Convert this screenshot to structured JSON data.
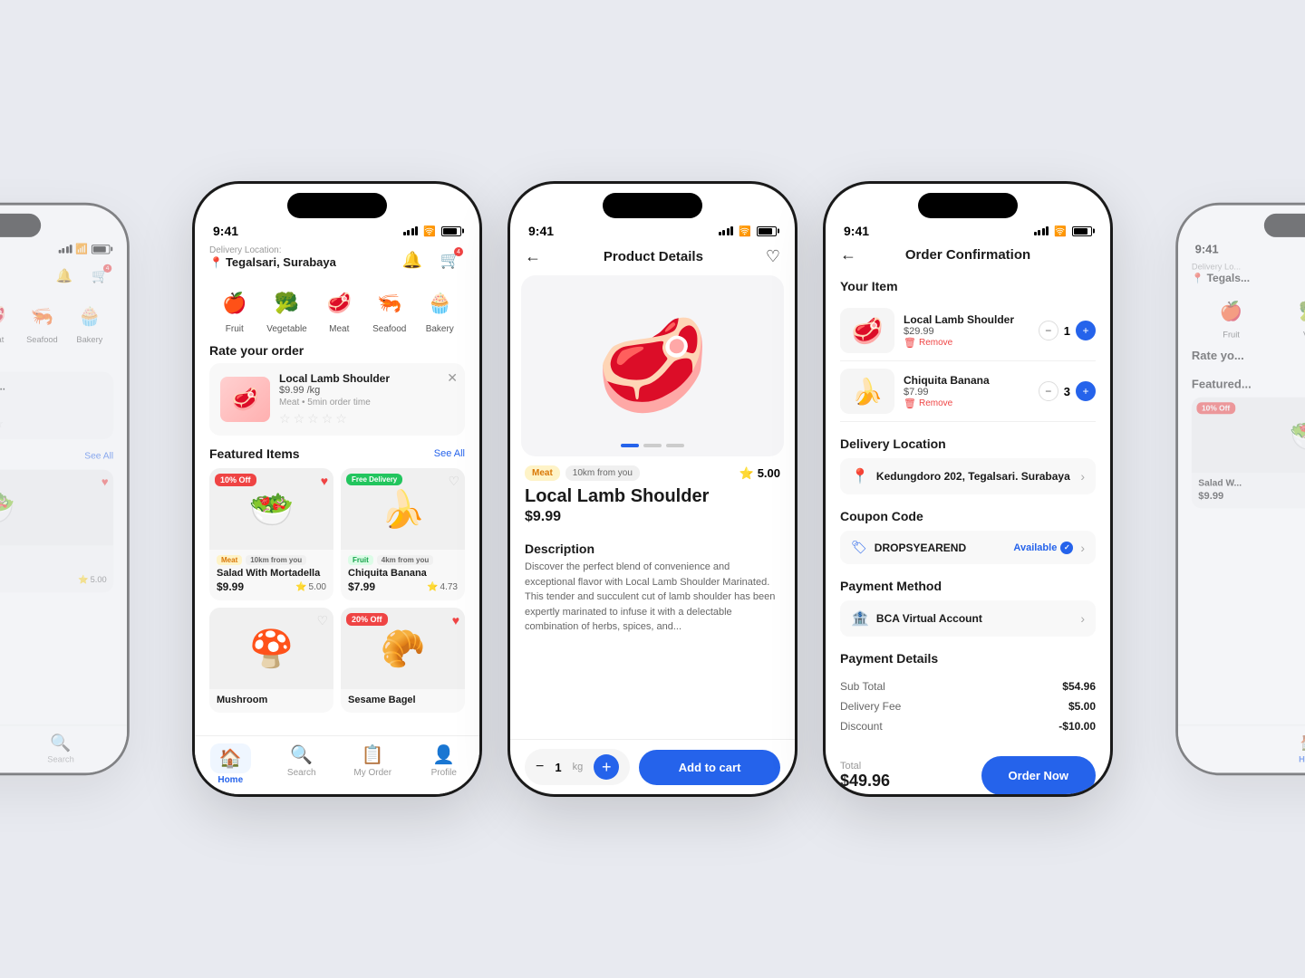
{
  "app": {
    "statusTime": "9:41",
    "theme": {
      "primary": "#2563eb",
      "danger": "#ef4444",
      "success": "#22c55e"
    }
  },
  "screen1": {
    "deliveryLabel": "Delivery Location:",
    "location": "Tegalsari, Surabaya",
    "categories": [
      {
        "icon": "🍎",
        "label": "Fruit"
      },
      {
        "icon": "🥦",
        "label": "Vegetable"
      },
      {
        "icon": "🥩",
        "label": "Meat"
      },
      {
        "icon": "🦐",
        "label": "Seafood"
      },
      {
        "icon": "🧁",
        "label": "Bakery"
      }
    ],
    "rateSection": {
      "title": "Rate your order",
      "product": {
        "name": "Local Lamb Shoulder",
        "price": "$9.99 /kg",
        "meta": "Meat • 5min order time"
      }
    },
    "featured": {
      "title": "Featured Items",
      "seeAll": "See All",
      "items": [
        {
          "badge": "10% Off",
          "badgeType": "discount",
          "name": "Salad With Mortadella",
          "price": "$9.99",
          "tags": [
            "Meat",
            "10km from you"
          ],
          "rating": "5.00",
          "heart": "filled"
        },
        {
          "badge": "Free Delivery",
          "badgeType": "free",
          "name": "Chiquita Banana",
          "price": "$7.99",
          "tags": [
            "Fruit",
            "4km from you"
          ],
          "rating": "4.73",
          "heart": "empty"
        }
      ]
    },
    "nav": [
      {
        "icon": "🏠",
        "label": "Home",
        "active": true
      },
      {
        "icon": "🔍",
        "label": "Search",
        "active": false
      },
      {
        "icon": "📋",
        "label": "My Order",
        "active": false
      },
      {
        "icon": "👤",
        "label": "Profile",
        "active": false
      }
    ]
  },
  "screen2": {
    "title": "Product Details",
    "product": {
      "name": "Local Lamb Shoulder",
      "price": "$9.99",
      "tags": [
        "Meat",
        "10km from you"
      ],
      "rating": "5.00",
      "description": "Discover the perfect blend of convenience and exceptional flavor with Local Lamb Shoulder Marinated. This tender and succulent cut of lamb shoulder has been expertly marinated to infuse it with a delectable combination of herbs, spices, and..."
    },
    "quantity": "1kg",
    "addToCart": "Add to cart"
  },
  "screen3": {
    "title": "Order Confirmation",
    "yourItem": "Your Item",
    "items": [
      {
        "name": "Local Lamb Shoulder",
        "price": "$29.99",
        "qty": 1,
        "emoji": "🥩"
      },
      {
        "name": "Chiquita Banana",
        "price": "$7.99",
        "qty": 3,
        "emoji": "🍌"
      }
    ],
    "deliveryLocation": {
      "label": "Delivery Location",
      "address": "Kedungdoro 202, Tegalsari. Surabaya"
    },
    "coupon": {
      "label": "Coupon Code",
      "code": "DROPSYEAREND",
      "status": "Available"
    },
    "payment": {
      "label": "Payment Method",
      "method": "BCA Virtual Account"
    },
    "paymentDetails": {
      "label": "Payment Details",
      "subTotal": {
        "label": "Sub Total",
        "value": "$54.96"
      },
      "deliveryFee": {
        "label": "Delivery Fee",
        "value": "$5.00"
      },
      "discount": {
        "label": "Discount",
        "value": "-$10.00"
      }
    },
    "total": {
      "label": "Total",
      "value": "$49.96"
    },
    "orderNow": "Order Now",
    "removeLabel": "Remove"
  }
}
